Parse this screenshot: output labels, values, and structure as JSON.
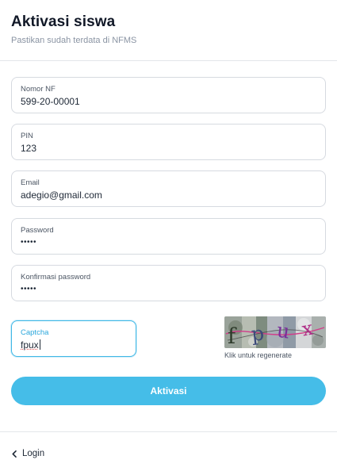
{
  "header": {
    "title": "Aktivasi siswa",
    "subtitle": "Pastikan sudah terdata di NFMS"
  },
  "form": {
    "nomor_nf": {
      "label": "Nomor NF",
      "value": "599-20-00001"
    },
    "pin": {
      "label": "PIN",
      "value": "123"
    },
    "email": {
      "label": "Email",
      "value": "adegio@gmail.com"
    },
    "password": {
      "label": "Password",
      "value": "•••••"
    },
    "confirm_password": {
      "label": "Konfirmasi password",
      "value": "•••••"
    },
    "captcha": {
      "label": "Captcha",
      "value": "fpux"
    },
    "captcha_image_text": "fpux",
    "captcha_hint": "Klik untuk regenerate",
    "submit_label": "Aktivasi"
  },
  "footer": {
    "back_label": "Login",
    "back_icon": "chevron-left-icon"
  },
  "colors": {
    "accent": "#45bde8",
    "focus_border": "#41b8e6"
  }
}
